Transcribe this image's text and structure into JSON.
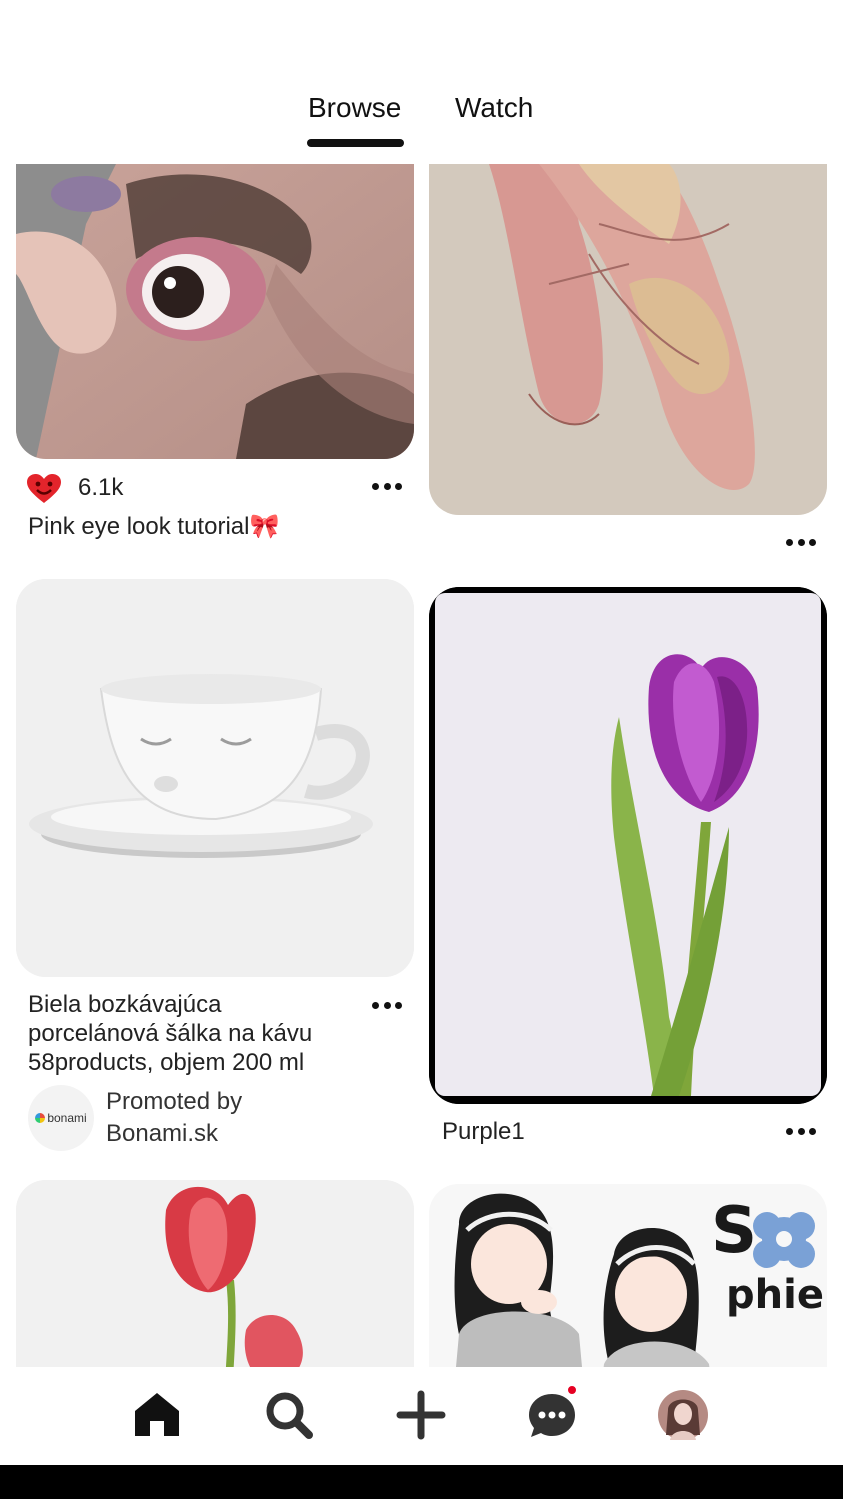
{
  "tabs": {
    "browse": "Browse",
    "watch": "Watch",
    "active": "Browse"
  },
  "pins": {
    "eye": {
      "likes": "6.1k",
      "title": "Pink eye look tutorial🎀"
    },
    "ballet": {},
    "cup": {
      "title_lines": [
        "Biela bozkávajúca",
        "porcelánová šálka na kávu",
        "58products, objem 200 ml"
      ],
      "promoted_label": "Promoted by",
      "advertiser": "Bonami.sk",
      "logo_text": "bonami"
    },
    "tulip": {
      "title": "Purple1"
    },
    "sophie": {
      "art_text_1": "S",
      "art_text_2": "phie"
    }
  },
  "nav": {
    "items": [
      "home-icon",
      "search-icon",
      "plus-icon",
      "chat-icon",
      "profile-avatar"
    ],
    "notification_color": "#e60023"
  },
  "colors": {
    "heart": "#e3242b",
    "brand_red": "#e60023"
  }
}
